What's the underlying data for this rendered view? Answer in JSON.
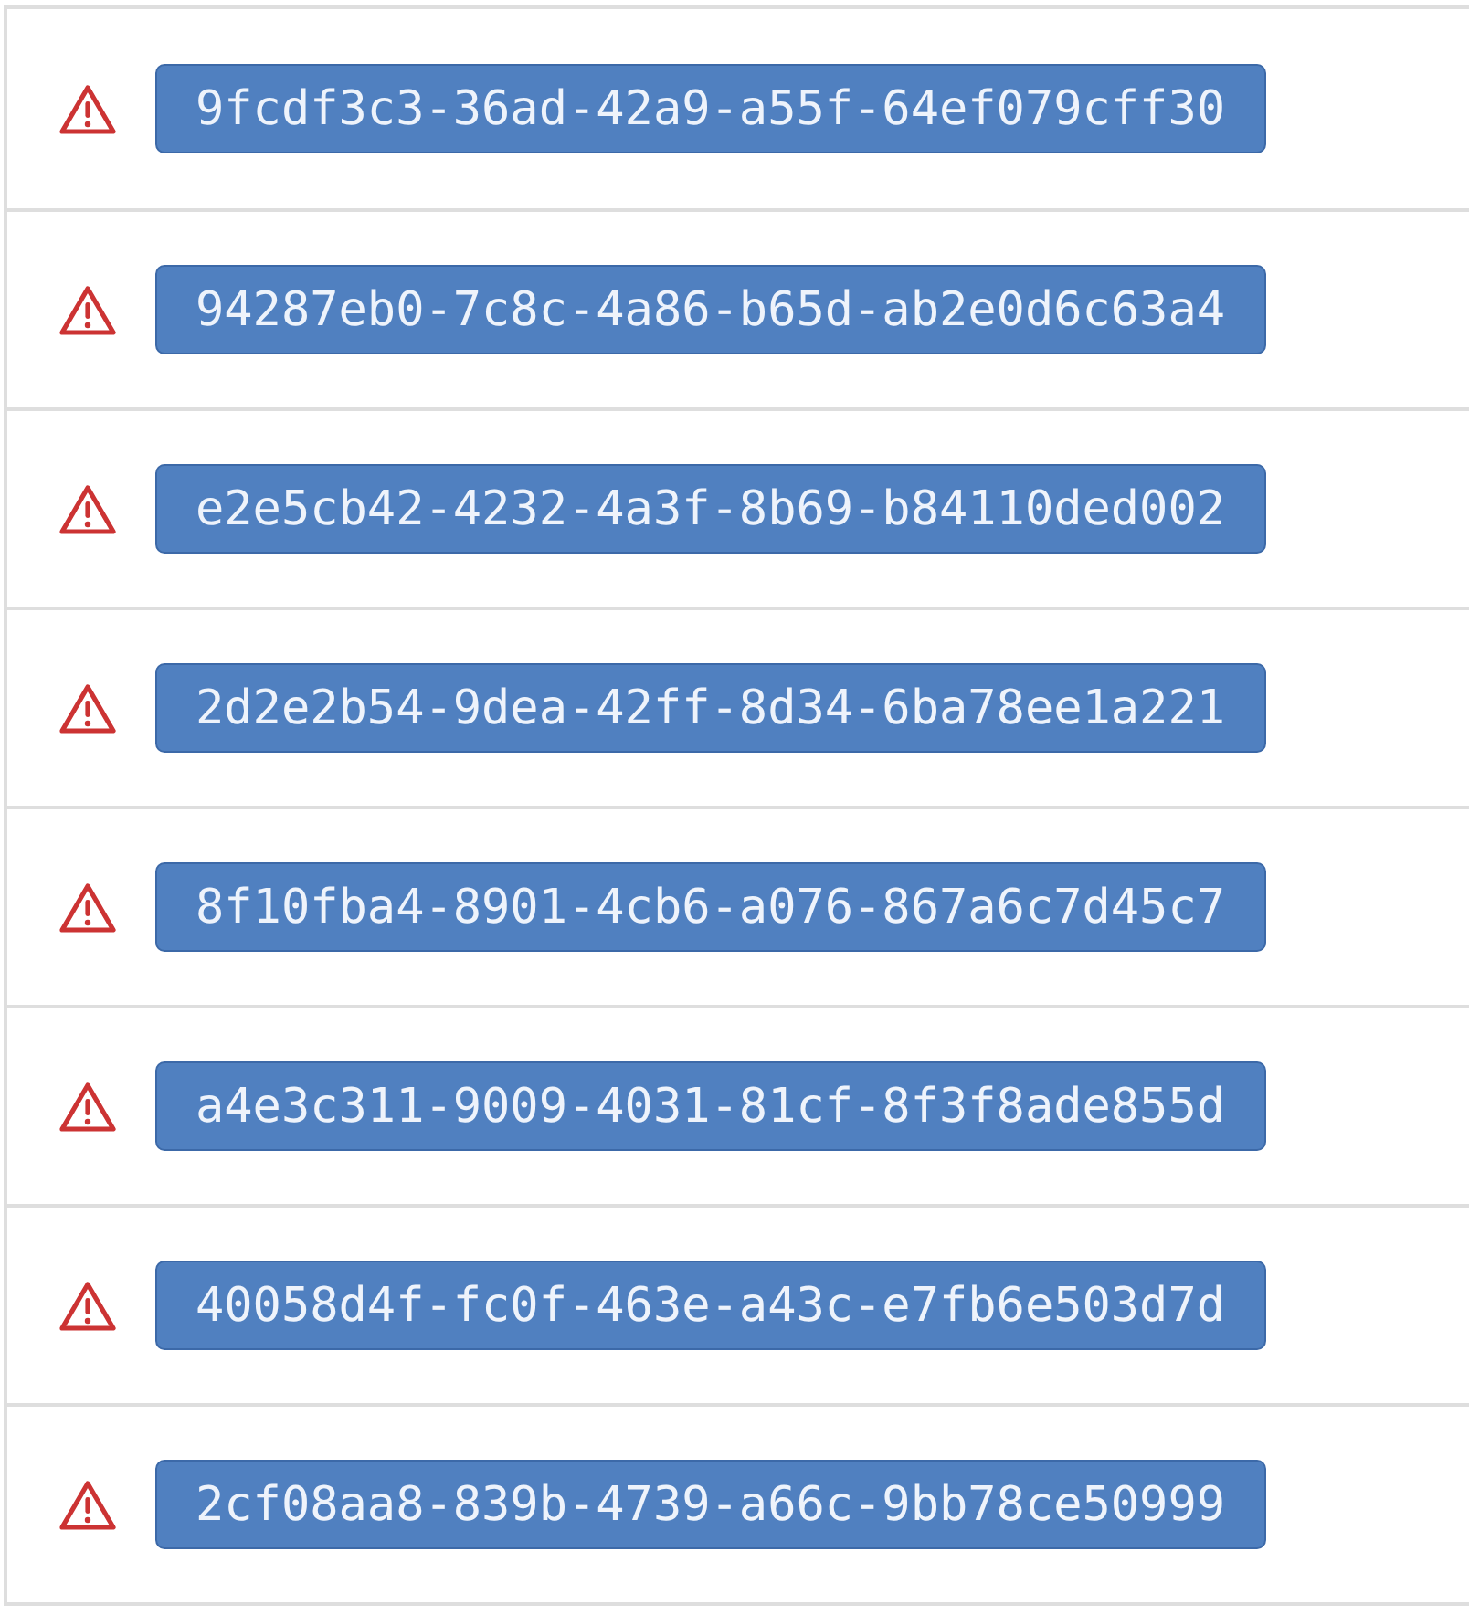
{
  "alerts": [
    {
      "id": "9fcdf3c3-36ad-42a9-a55f-64ef079cff30"
    },
    {
      "id": "94287eb0-7c8c-4a86-b65d-ab2e0d6c63a4"
    },
    {
      "id": "e2e5cb42-4232-4a3f-8b69-b84110ded002"
    },
    {
      "id": "2d2e2b54-9dea-42ff-8d34-6ba78ee1a221"
    },
    {
      "id": "8f10fba4-8901-4cb6-a076-867a6c7d45c7"
    },
    {
      "id": "a4e3c311-9009-4031-81cf-8f3f8ade855d"
    },
    {
      "id": "40058d4f-fc0f-463e-a43c-e7fb6e503d7d"
    },
    {
      "id": "2cf08aa8-839b-4739-a66c-9bb78ce50999"
    }
  ]
}
